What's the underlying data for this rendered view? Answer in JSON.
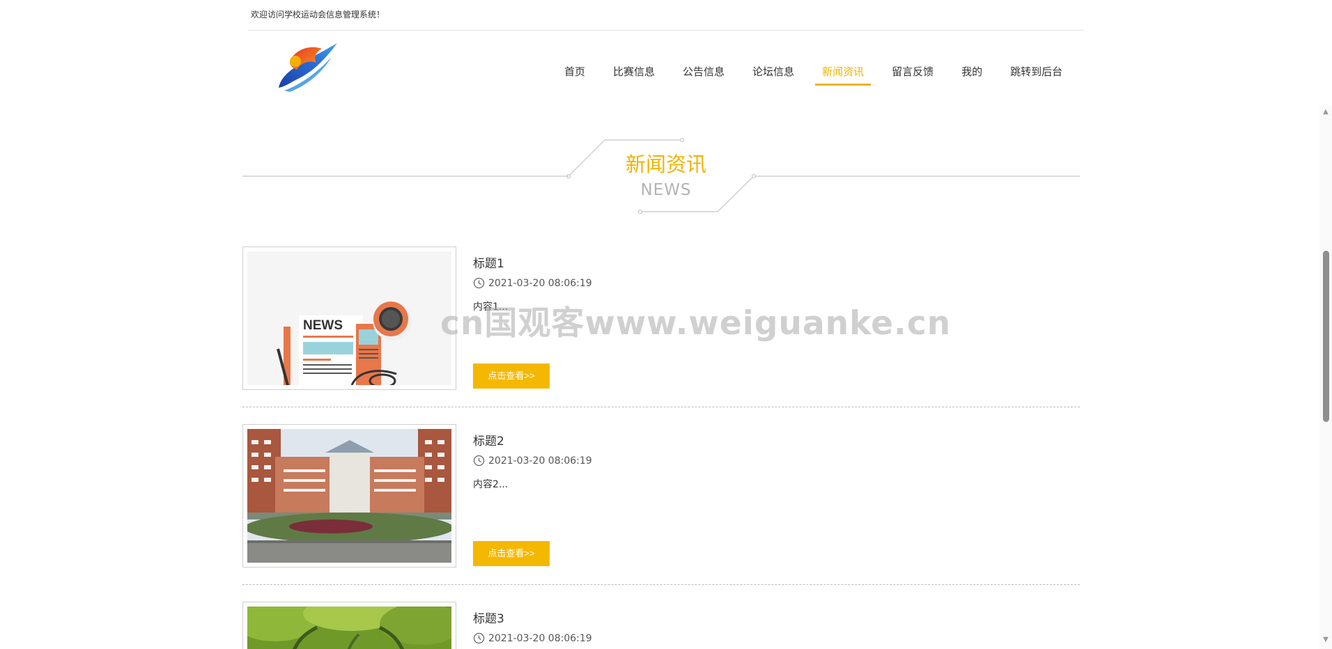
{
  "header": {
    "welcome_text": "欢迎访问学校运动会信息管理系统！",
    "nav": [
      {
        "label": "首页",
        "active": false
      },
      {
        "label": "比赛信息",
        "active": false
      },
      {
        "label": "公告信息",
        "active": false
      },
      {
        "label": "论坛信息",
        "active": false
      },
      {
        "label": "新闻资讯",
        "active": true
      },
      {
        "label": "留言反馈",
        "active": false
      },
      {
        "label": "我的",
        "active": false
      },
      {
        "label": "跳转到后台",
        "active": false
      }
    ]
  },
  "section": {
    "title": "新闻资讯",
    "subtitle": "NEWS"
  },
  "news": [
    {
      "title": "标题1",
      "date": "2021-03-20 08:06:19",
      "summary": "内容1...",
      "button": "点击查看>>",
      "image": "news-newspaper-illustration"
    },
    {
      "title": "标题2",
      "date": "2021-03-20 08:06:19",
      "summary": "内容2...",
      "button": "点击查看>>",
      "image": "school-building-photo"
    },
    {
      "title": "标题3",
      "date": "2021-03-20 08:06:19",
      "summary": "",
      "button": "",
      "image": "green-trees-photo"
    }
  ],
  "watermark": "cn国观客www.weiguanke.cn",
  "colors": {
    "accent": "#f0b400",
    "button": "#f5b800",
    "text": "#333333",
    "subtitle": "#b3b3b3"
  }
}
